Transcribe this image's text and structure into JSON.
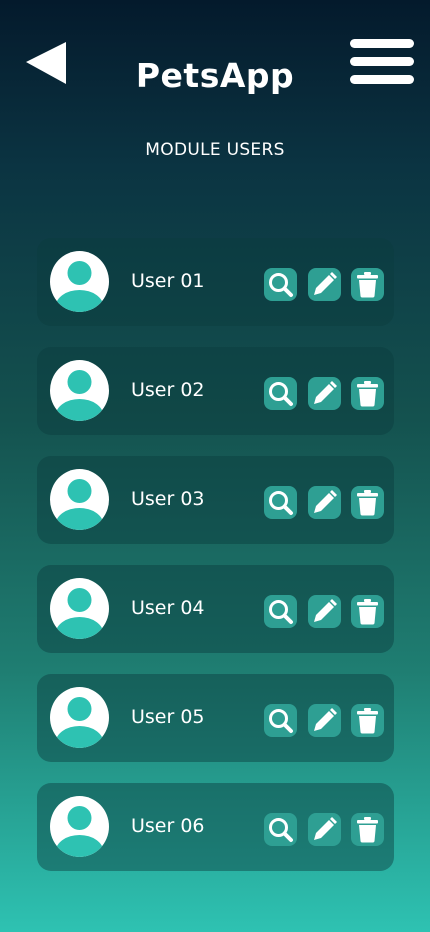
{
  "header": {
    "app_title": "PetsApp",
    "module_title": "MODULE USERS",
    "back_icon": "back-arrow-icon",
    "menu_icon": "hamburger-menu-icon"
  },
  "users": [
    {
      "name": "User 01"
    },
    {
      "name": "User 02"
    },
    {
      "name": "User 03"
    },
    {
      "name": "User 04"
    },
    {
      "name": "User 05"
    },
    {
      "name": "User 06"
    }
  ],
  "row_actions": [
    "search-icon",
    "edit-pencil-icon",
    "trash-icon"
  ],
  "colors": {
    "background_top": "#041a2c",
    "background_bottom": "#2ec2b2",
    "card": "#1d5c5b",
    "action_button": "#2e9f93",
    "avatar_figure": "#2ec2b2",
    "text": "#ffffff"
  }
}
